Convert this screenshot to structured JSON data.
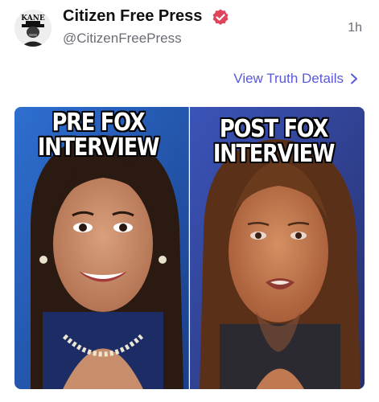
{
  "post": {
    "display_name": "Citizen Free Press",
    "handle": "@CitizenFreePress",
    "timestamp": "1h",
    "view_details_label": "View Truth Details",
    "avatar_text": "KANE",
    "verified": true
  },
  "meme": {
    "left_caption": "PRE FOX\nINTERVIEW",
    "right_caption": "POST FOX\nINTERVIEW"
  },
  "colors": {
    "link": "#5a5ad6",
    "verified_badge": "#e0445a",
    "muted_text": "#6b6b74"
  },
  "icons": {
    "verified": "verified-badge-icon",
    "view_details": "chevron-right-icon"
  }
}
